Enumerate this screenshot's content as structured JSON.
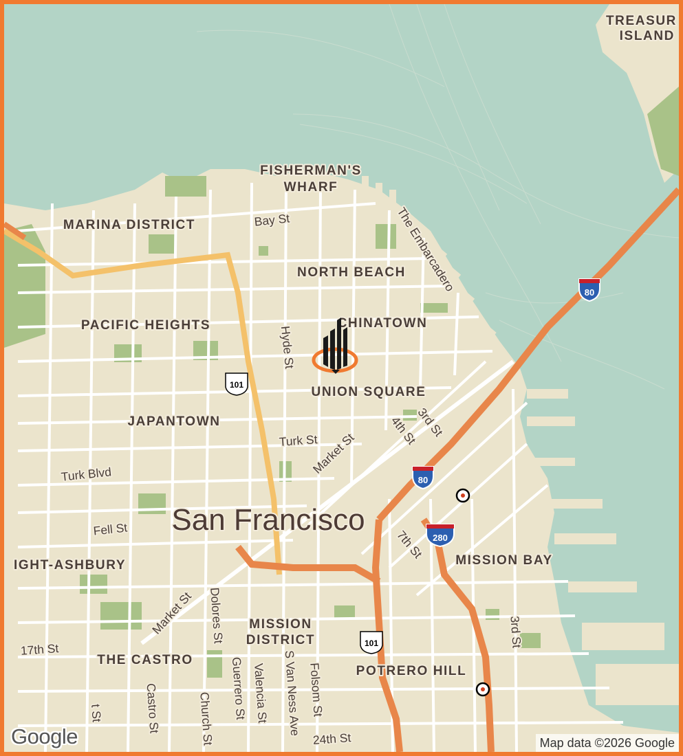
{
  "map": {
    "city_label": "San Francisco",
    "districts": {
      "treasure_island_1": "TREASUR",
      "treasure_island_2": "ISLAND",
      "fishermans_wharf_1": "FISHERMAN'S",
      "fishermans_wharf_2": "WHARF",
      "marina": "MARINA DISTRICT",
      "north_beach": "NORTH BEACH",
      "pacific_heights": "PACIFIC HEIGHTS",
      "chinatown": "CHINATOWN",
      "union_square": "UNION SQUARE",
      "japantown": "JAPANTOWN",
      "haight": "IGHT-ASHBURY",
      "mission_bay": "MISSION BAY",
      "mission_1": "MISSION",
      "mission_2": "DISTRICT",
      "castro": "THE CASTRO",
      "potrero": "POTRERO HILL"
    },
    "streets": {
      "bay": "Bay St",
      "embarcadero": "The Embarcadero",
      "hyde": "Hyde St",
      "turk": "Turk St",
      "market_1": "Market St",
      "fourth": "4th St",
      "third_1": "3rd St",
      "turk_blvd": "Turk Blvd",
      "fell": "Fell St",
      "seventh": "7th St",
      "market_2": "Market St",
      "dolores": "Dolores St",
      "seventeenth": "17th St",
      "guerrero": "Guerrero St",
      "valencia": "Valencia St",
      "s_van_ness": "S Van Ness Ave",
      "folsom": "Folsom St",
      "castro": "Castro St",
      "church": "Church St",
      "twenty_fourth": "24th St",
      "third_2": "3rd St",
      "market_3": "t St"
    },
    "shields": {
      "i80_east": "80",
      "i80_mid": "80",
      "i280": "280",
      "us101_north": "101",
      "us101_south": "101"
    },
    "colors": {
      "water": "#b3d4c6",
      "land": "#ebe4cc",
      "park": "#a9c288",
      "freeway": "#e8864a",
      "highway": "#f4c16a",
      "frame": "#f07a30"
    },
    "icons": {
      "marker": "building-marker-icon",
      "transit": "train-station-icon"
    }
  },
  "branding": {
    "logo": "Google",
    "attribution": "Map data ©2026 Google"
  }
}
